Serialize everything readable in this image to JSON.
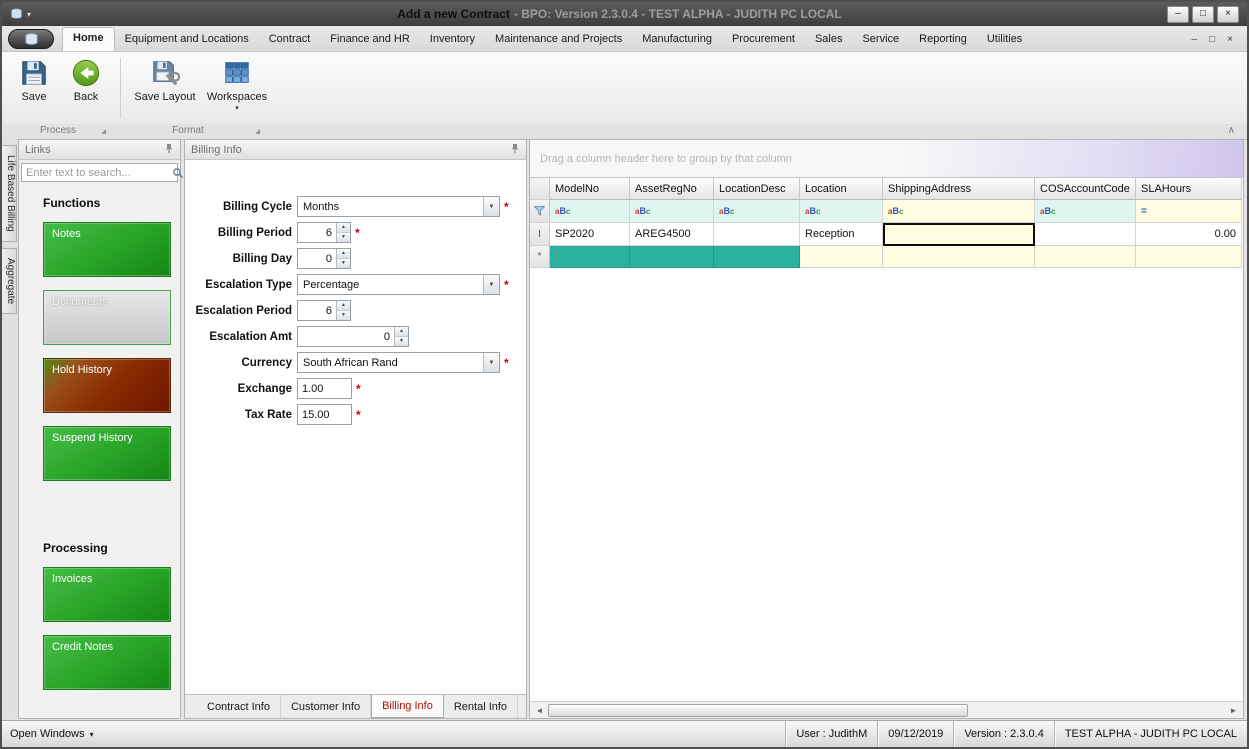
{
  "window": {
    "title_main": "Add a new Contract",
    "title_rest": "- BPO: Version 2.3.0.4 - TEST ALPHA - JUDITH PC LOCAL"
  },
  "ribbon": {
    "tabs": [
      {
        "label": "Home"
      },
      {
        "label": "Equipment and Locations"
      },
      {
        "label": "Contract"
      },
      {
        "label": "Finance and HR"
      },
      {
        "label": "Inventory"
      },
      {
        "label": "Maintenance and Projects"
      },
      {
        "label": "Manufacturing"
      },
      {
        "label": "Procurement"
      },
      {
        "label": "Sales"
      },
      {
        "label": "Service"
      },
      {
        "label": "Reporting"
      },
      {
        "label": "Utilities"
      }
    ],
    "buttons": {
      "save": "Save",
      "back": "Back",
      "save_layout": "Save Layout",
      "workspaces": "Workspaces"
    },
    "groups": {
      "process": "Process",
      "format": "Format"
    }
  },
  "side_tabs": {
    "tab1": "Life Based Billing",
    "tab2": "Aggregate"
  },
  "links_panel": {
    "title": "Links",
    "search_placeholder": "Enter text to search...",
    "functions_heading": "Functions",
    "function_tiles": [
      {
        "label": "Notes"
      },
      {
        "label": "Documents"
      },
      {
        "label": "Hold History"
      },
      {
        "label": "Suspend History"
      }
    ],
    "processing_heading": "Processing",
    "processing_tiles": [
      {
        "label": "Invoices"
      },
      {
        "label": "Credit Notes"
      }
    ]
  },
  "billing_panel": {
    "title": "Billing Info",
    "required_marker": "*",
    "fields": [
      {
        "label": "Billing Cycle",
        "value": "Months"
      },
      {
        "label": "Billing Period",
        "value": "6"
      },
      {
        "label": "Billing Day",
        "value": "0"
      },
      {
        "label": "Escalation Type",
        "value": "Percentage"
      },
      {
        "label": "Escalation Period",
        "value": "6"
      },
      {
        "label": "Escalation Amt",
        "value": "0"
      },
      {
        "label": "Currency",
        "value": "South African Rand"
      },
      {
        "label": "Exchange",
        "value": "1.00"
      },
      {
        "label": "Tax Rate",
        "value": "15.00"
      }
    ],
    "tabs": [
      {
        "label": "Contract Info"
      },
      {
        "label": "Customer Info"
      },
      {
        "label": "Billing Info"
      },
      {
        "label": "Rental Info"
      }
    ]
  },
  "grid": {
    "group_hint": "Drag a column header here to group by that column",
    "columns": [
      "ModelNo",
      "AssetRegNo",
      "LocationDesc",
      "Location",
      "ShippingAddress",
      "COSAccountCode",
      "SLAHours"
    ],
    "filter_icon_letters": [
      "a",
      "B",
      "c"
    ],
    "filter_row": {
      "sla_operator": "="
    },
    "rows": [
      {
        "indicator": "I",
        "c0": "SP2020",
        "c1": "AREG4500",
        "c2": "",
        "c3": "Reception",
        "c4": "",
        "c5": "",
        "c6": "0.00"
      }
    ],
    "new_row_indicator": "*"
  },
  "status_bar": {
    "open_windows": "Open Windows",
    "user": "User : JudithM",
    "date": "09/12/2019",
    "version": "Version : 2.3.0.4",
    "environment": "TEST ALPHA - JUDITH PC LOCAL"
  },
  "colors": {
    "tile_green": "#27a327",
    "tile_hold_red": "#8a2a00",
    "new_row_teal": "#2bb19e",
    "filter_yellow": "#fffde1",
    "filter_teal": "#e1f5f0",
    "required_red": "#cc0000",
    "active_tab_text_red": "#b21000"
  },
  "icons": {
    "caret_down": "▼",
    "caret_down_small": "▾",
    "spin_up": "▲",
    "spin_down": "▼",
    "minimize": "–",
    "maximize": "□",
    "close": "×",
    "launcher": "◢",
    "collapse_chevron": "∧",
    "arrow_left": "◄",
    "arrow_right": "►"
  }
}
